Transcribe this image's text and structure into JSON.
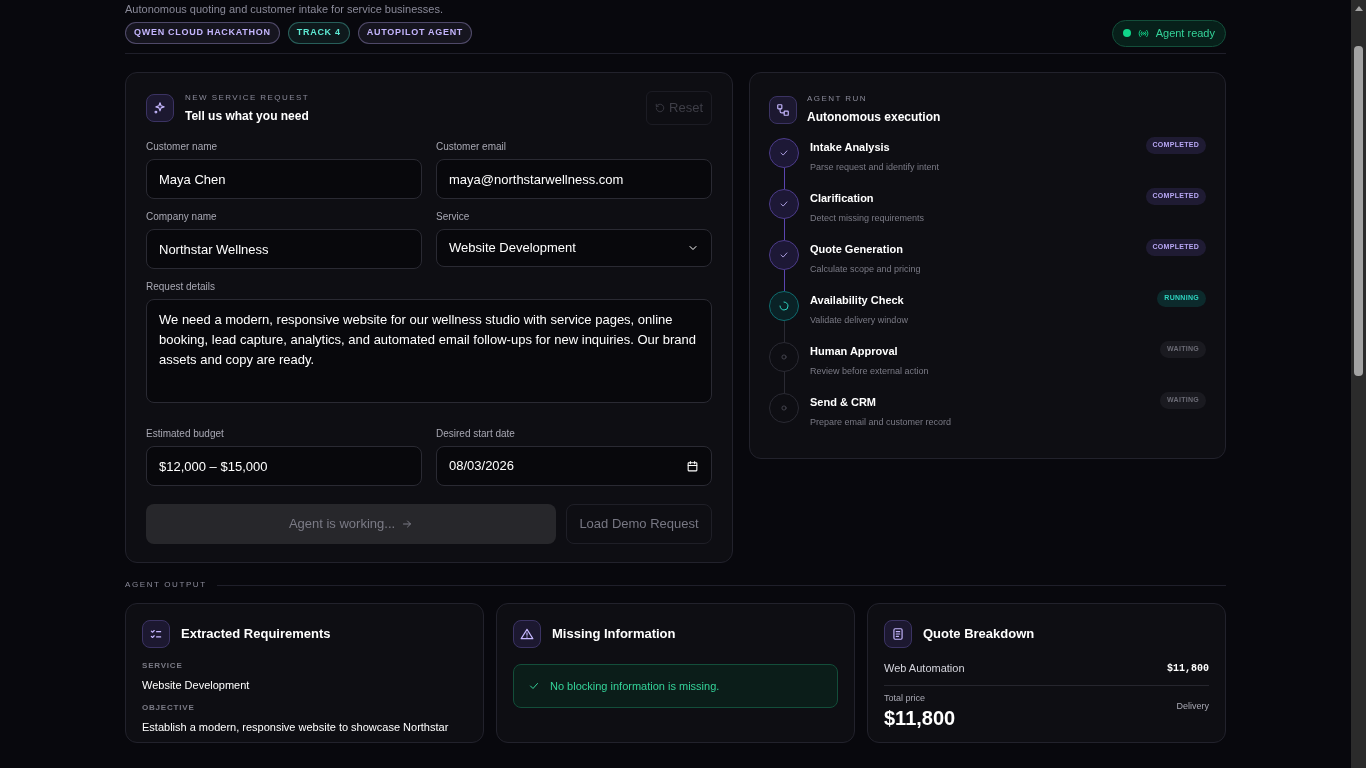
{
  "header": {
    "subtitle": "Autonomous quoting and customer intake for service businesses.",
    "badges": [
      {
        "label": "QWEN CLOUD HACKATHON",
        "color": "#c4b5fd"
      },
      {
        "label": "TRACK 4",
        "color": "#5eead4"
      },
      {
        "label": "AUTOPILOT AGENT",
        "color": "#c4b5fd"
      }
    ],
    "status": {
      "label": "Agent ready",
      "on": true
    }
  },
  "request_form": {
    "eyebrow": "NEW SERVICE REQUEST",
    "title": "Tell us what you need",
    "reset_button": {
      "label": "Reset",
      "disabled": true
    },
    "fields": [
      {
        "kind": "text",
        "label": "Customer name",
        "value": "Maya Chen"
      },
      {
        "kind": "text",
        "label": "Customer email",
        "value": "maya@northstarwellness.com"
      },
      {
        "kind": "text",
        "label": "Company name",
        "value": "Northstar Wellness"
      },
      {
        "kind": "select",
        "label": "Service",
        "value": "Website Development"
      },
      {
        "kind": "textarea",
        "label": "Request details",
        "value": "We need a modern, responsive website for our wellness studio with service pages, online booking, lead capture, analytics, and automated email follow-ups for new inquiries. Our brand assets and copy are ready."
      },
      {
        "kind": "text",
        "label": "Estimated budget",
        "value": "$12,000 – $15,000"
      },
      {
        "kind": "date",
        "label": "Desired start date",
        "value": "08/03/2026"
      }
    ],
    "submit_button": {
      "label": "Agent is working...",
      "disabled": true
    },
    "demo_button": {
      "label": "Load Demo Request"
    }
  },
  "agent_run": {
    "eyebrow": "AGENT RUN",
    "title": "Autonomous execution",
    "steps": [
      {
        "title": "Intake Analysis",
        "subtitle": "Parse request and identify intent",
        "status": "COMPLETED"
      },
      {
        "title": "Clarification",
        "subtitle": "Detect missing requirements",
        "status": "COMPLETED"
      },
      {
        "title": "Quote Generation",
        "subtitle": "Calculate scope and pricing",
        "status": "COMPLETED"
      },
      {
        "title": "Availability Check",
        "subtitle": "Validate delivery window",
        "status": "RUNNING"
      },
      {
        "title": "Human Approval",
        "subtitle": "Review before external action",
        "status": "WAITING"
      },
      {
        "title": "Send & CRM",
        "subtitle": "Prepare email and customer record",
        "status": "WAITING"
      }
    ]
  },
  "output": {
    "section_label": "AGENT OUTPUT",
    "requirements": {
      "title": "Extracted Requirements",
      "items": [
        {
          "label": "SERVICE",
          "value": "Website Development"
        },
        {
          "label": "OBJECTIVE",
          "value": "Establish a modern, responsive website to showcase Northstar"
        }
      ]
    },
    "missing": {
      "title": "Missing Information",
      "message": "No blocking information is missing."
    },
    "quote": {
      "title": "Quote Breakdown",
      "lines": [
        {
          "name": "Web Automation",
          "amount": "$11,800"
        }
      ],
      "total_label": "Total price",
      "total": "$11,800",
      "delivery_label": "Delivery"
    }
  }
}
